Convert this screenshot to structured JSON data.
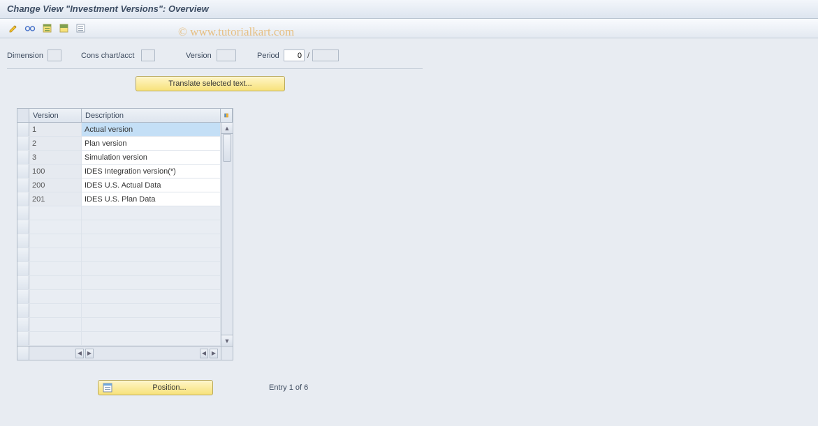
{
  "title": "Change View \"Investment Versions\": Overview",
  "watermark": "© www.tutorialkart.com",
  "toolbar": {
    "icons": [
      "pencil-select",
      "glasses-toggle",
      "select-all",
      "select-block",
      "deselect-all"
    ]
  },
  "params": {
    "dimension_label": "Dimension",
    "dimension_value": "",
    "cons_chart_label": "Cons chart/acct",
    "cons_chart_value": "",
    "version_label": "Version",
    "version_value": "",
    "period_label": "Period",
    "period_value": "0",
    "period_year": ""
  },
  "translate_button": "Translate selected text...",
  "table": {
    "col_version": "Version",
    "col_description": "Description",
    "rows": [
      {
        "version": "1",
        "description": "Actual version",
        "selected": true
      },
      {
        "version": "2",
        "description": "Plan version"
      },
      {
        "version": "3",
        "description": "Simulation version"
      },
      {
        "version": "100",
        "description": "IDES Integration version(*)"
      },
      {
        "version": "200",
        "description": "IDES U.S. Actual Data"
      },
      {
        "version": "201",
        "description": "IDES U.S. Plan Data"
      }
    ],
    "empty_rows": 10
  },
  "footer": {
    "position_label": "Position...",
    "entry_text": "Entry 1 of 6"
  }
}
